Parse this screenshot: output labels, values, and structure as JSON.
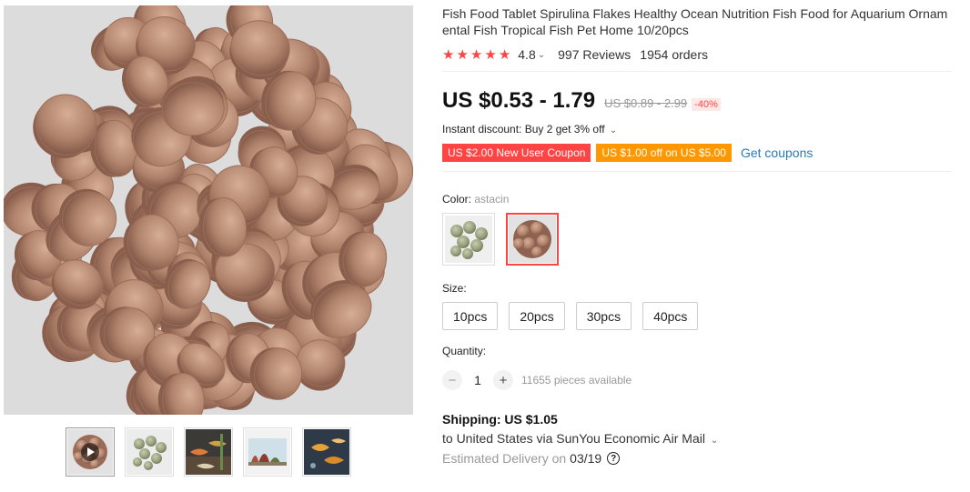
{
  "product": {
    "title": "Fish Food Tablet Spirulina Flakes Healthy Ocean Nutrition Fish Food for Aquarium Ornamental Fish Tropical Fish Pet Home 10/20pcs",
    "main_image": "brown-fish-food-tablets",
    "thumbnails": [
      "brown-tablets-video",
      "green-tablets",
      "aquarium-fish-1",
      "aquarium-tank-red-plants",
      "aquarium-fish-2"
    ]
  },
  "rating": {
    "stars_filled": 5,
    "star_color": "#ff4747",
    "value": "4.8",
    "reviews": "997 Reviews",
    "orders": "1954 orders"
  },
  "price": {
    "current": "US $0.53 - 1.79",
    "original": "US $0.89 - 2.99",
    "discount": "-40%"
  },
  "instant_discount": "Instant discount: Buy 2 get 3% off",
  "coupons": {
    "new_user": "US $2.00 New User Coupon",
    "off": "US $1.00 off on US $5.00",
    "get": "Get coupons"
  },
  "color": {
    "label": "Color:",
    "selected": "astacin",
    "options": [
      "green-tablets",
      "astacin"
    ]
  },
  "size": {
    "label": "Size:",
    "options": [
      "10pcs",
      "20pcs",
      "30pcs",
      "40pcs"
    ]
  },
  "quantity": {
    "label": "Quantity:",
    "value": "1",
    "available": "11655 pieces available"
  },
  "shipping": {
    "cost": "Shipping: US $1.05",
    "route": "to United States via SunYou Economic Air Mail",
    "estimated_label": "Estimated Delivery on",
    "estimated_date": "03/19"
  },
  "colors": {
    "accent_red": "#ff4747",
    "coupon_orange": "#ff9800",
    "link_blue": "#2a7ab8"
  }
}
